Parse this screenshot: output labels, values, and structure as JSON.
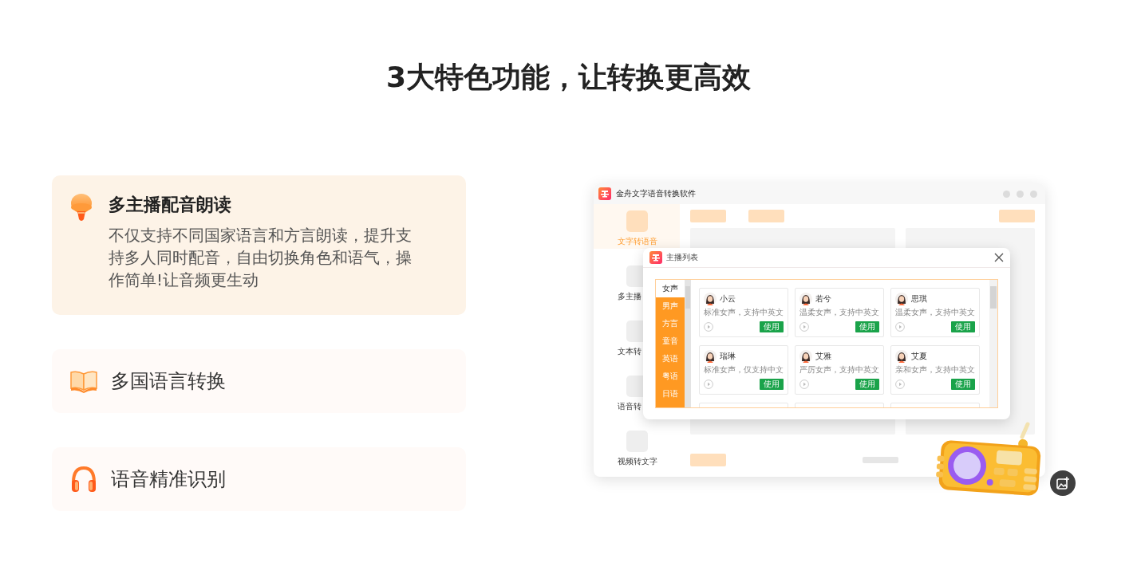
{
  "heading": "3大特色功能，让转换更高效",
  "features": [
    {
      "title": "多主播配音朗读",
      "description": "不仅支持不同国家语言和方言朗读，提升支持多人同时配音，自由切换角色和语气，操作简单!让音频更生动",
      "expanded": true
    },
    {
      "title": "多国语言转换",
      "expanded": false
    },
    {
      "title": "语音精准识别",
      "expanded": false
    }
  ],
  "app_window": {
    "title": "金舟文字语音转换软件",
    "sidebar": [
      {
        "label": "文字转语音",
        "selected": true
      },
      {
        "label": "多主播",
        "selected": false
      },
      {
        "label": "文本转",
        "selected": false
      },
      {
        "label": "语音转",
        "selected": false
      },
      {
        "label": "视频转文字",
        "selected": false
      }
    ],
    "dialog": {
      "title": "主播列表",
      "categories": [
        {
          "label": "女声",
          "selected": true
        },
        {
          "label": "男声",
          "selected": false
        },
        {
          "label": "方言",
          "selected": false
        },
        {
          "label": "童音",
          "selected": false
        },
        {
          "label": "英语",
          "selected": false
        },
        {
          "label": "粤语",
          "selected": false
        },
        {
          "label": "日语",
          "selected": false
        }
      ],
      "voices": [
        {
          "kind": "full",
          "name": "小云",
          "description": "标准女声，支持中英文",
          "action": "使用"
        },
        {
          "kind": "full",
          "name": "若兮",
          "description": "温柔女声，支持中英文",
          "action": "使用"
        },
        {
          "kind": "full",
          "name": "思琪",
          "description": "温柔女声，支持中英文",
          "action": "使用"
        },
        {
          "kind": "full",
          "name": "瑞琳",
          "description": "标准女声，仅支持中文",
          "action": "使用"
        },
        {
          "kind": "full",
          "name": "艾雅",
          "description": "严厉女声，支持中英文",
          "action": "使用"
        },
        {
          "kind": "full",
          "name": "艾夏",
          "description": "亲和女声，支持中英文",
          "action": "使用"
        },
        {
          "kind": "cut"
        },
        {
          "kind": "cut"
        },
        {
          "kind": "cut"
        }
      ]
    }
  }
}
